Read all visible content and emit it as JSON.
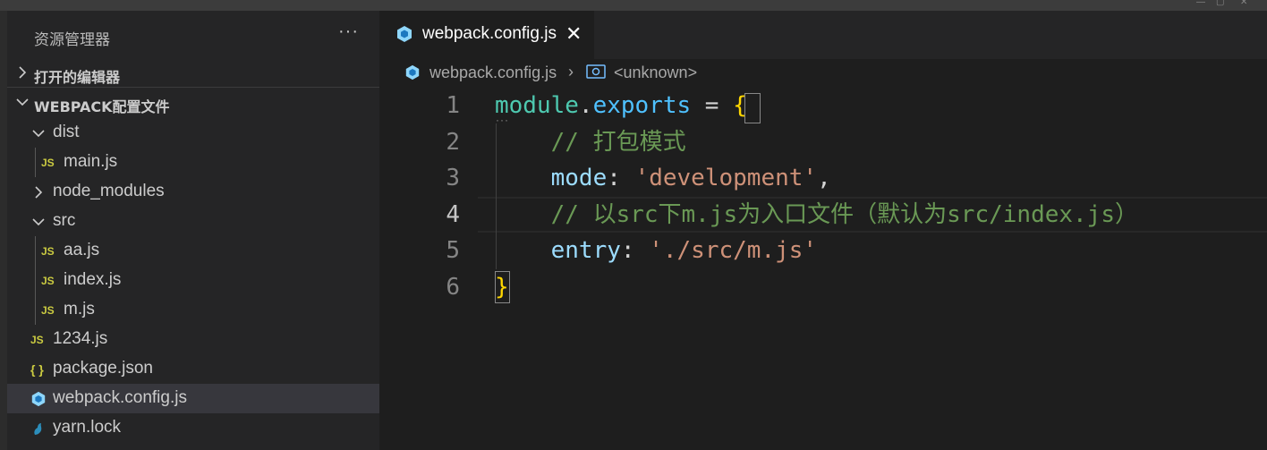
{
  "sidebar": {
    "title": "资源管理器",
    "more": "···",
    "open_editors": "打开的编辑器",
    "project": "WEBPACK配置文件",
    "tree": [
      {
        "name": "dist",
        "kind": "folder",
        "expanded": true,
        "depth": 1
      },
      {
        "name": "main.js",
        "kind": "js",
        "depth": 2
      },
      {
        "name": "node_modules",
        "kind": "folder",
        "expanded": false,
        "depth": 1
      },
      {
        "name": "src",
        "kind": "folder",
        "expanded": true,
        "depth": 1
      },
      {
        "name": "aa.js",
        "kind": "js",
        "depth": 2
      },
      {
        "name": "index.js",
        "kind": "js",
        "depth": 2
      },
      {
        "name": "m.js",
        "kind": "js",
        "depth": 2
      },
      {
        "name": "1234.js",
        "kind": "js",
        "depth": 1
      },
      {
        "name": "package.json",
        "kind": "json",
        "depth": 1
      },
      {
        "name": "webpack.config.js",
        "kind": "webpack",
        "depth": 1,
        "selected": true
      },
      {
        "name": "yarn.lock",
        "kind": "yarn",
        "depth": 1
      }
    ],
    "icons": {
      "js": "JS",
      "json": "{ }"
    }
  },
  "tab": {
    "label": "webpack.config.js",
    "close": "✕"
  },
  "breadcrumb": {
    "file": "webpack.config.js",
    "sep": "›",
    "symbol": "<unknown>"
  },
  "editor": {
    "line_numbers": [
      "1",
      "2",
      "3",
      "4",
      "5",
      "6"
    ],
    "active_line": 4,
    "lines": [
      [
        {
          "t": "module",
          "c": "var"
        },
        {
          "t": ".",
          "c": "punc"
        },
        {
          "t": "exports",
          "c": "prop"
        },
        {
          "t": " = ",
          "c": "punc"
        },
        {
          "t": "{",
          "c": "brace"
        }
      ],
      [
        {
          "t": "    // 打包模式",
          "c": "com"
        }
      ],
      [
        {
          "t": "    ",
          "c": "punc"
        },
        {
          "t": "mode",
          "c": "key"
        },
        {
          "t": ": ",
          "c": "punc"
        },
        {
          "t": "'development'",
          "c": "str"
        },
        {
          "t": ",",
          "c": "punc"
        }
      ],
      [
        {
          "t": "    // 以src下m.js为入口文件（默认为src/index.js）",
          "c": "com"
        }
      ],
      [
        {
          "t": "    ",
          "c": "punc"
        },
        {
          "t": "entry",
          "c": "key"
        },
        {
          "t": ": ",
          "c": "punc"
        },
        {
          "t": "'./src/m.js'",
          "c": "str"
        }
      ],
      [
        {
          "t": "}",
          "c": "brace"
        }
      ]
    ]
  },
  "colors": {
    "sidebar_bg": "#252526",
    "editor_bg": "#1e1e1e",
    "selected_row": "#37373d",
    "js_icon": "#cbcb41",
    "webpack_icon": "#8ed6fb",
    "yarn_icon": "#2c8ebb"
  }
}
